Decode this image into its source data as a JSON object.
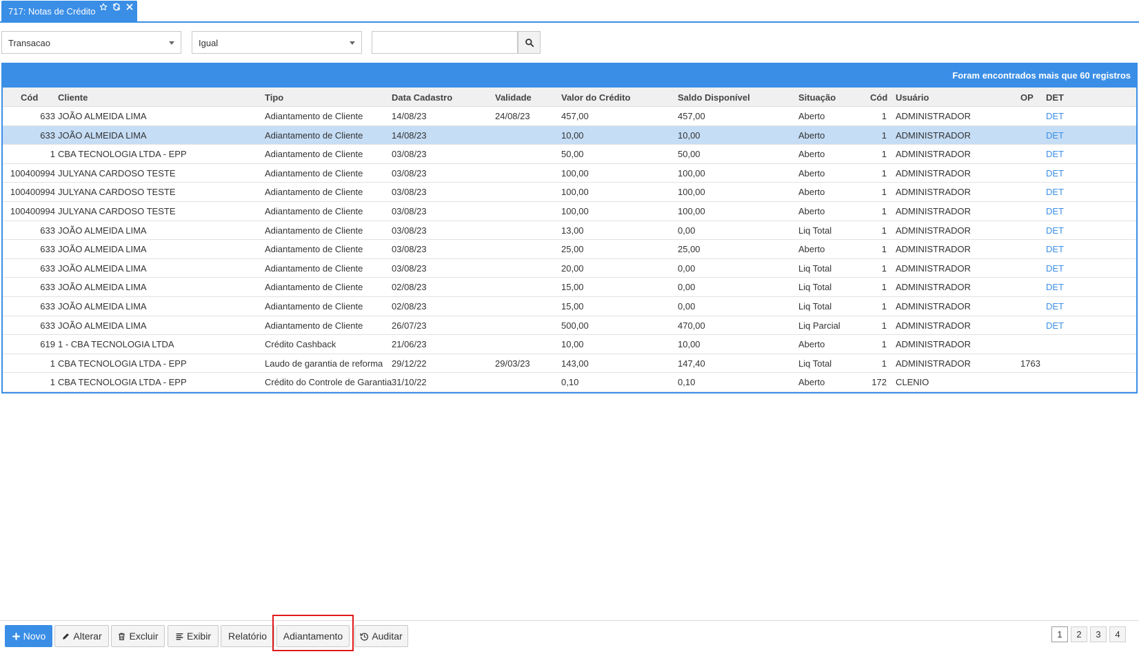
{
  "tab": {
    "title": "717: Notas de Crédito"
  },
  "filters": {
    "field": "Transacao",
    "operator": "Igual",
    "search_value": ""
  },
  "grid": {
    "records_info": "Foram encontrados mais que 60 registros",
    "columns": [
      "Cód",
      "Cliente",
      "Tipo",
      "Data Cadastro",
      "Validade",
      "Valor do Crédito",
      "Saldo Disponível",
      "Situação",
      "Cód",
      "Usuário",
      "OP",
      "DET"
    ],
    "rows": [
      [
        "633",
        "JOÃO ALMEIDA LIMA",
        "Adiantamento de Cliente",
        "14/08/23",
        "24/08/23",
        "457,00",
        "457,00",
        "Aberto",
        "1",
        "ADMINISTRADOR",
        "",
        "DET"
      ],
      [
        "633",
        "JOÃO ALMEIDA LIMA",
        "Adiantamento de Cliente",
        "14/08/23",
        "",
        "10,00",
        "10,00",
        "Aberto",
        "1",
        "ADMINISTRADOR",
        "",
        "DET"
      ],
      [
        "1",
        "CBA TECNOLOGIA LTDA - EPP",
        "Adiantamento de Cliente",
        "03/08/23",
        "",
        "50,00",
        "50,00",
        "Aberto",
        "1",
        "ADMINISTRADOR",
        "",
        "DET"
      ],
      [
        "100400994",
        "JULYANA CARDOSO TESTE",
        "Adiantamento de Cliente",
        "03/08/23",
        "",
        "100,00",
        "100,00",
        "Aberto",
        "1",
        "ADMINISTRADOR",
        "",
        "DET"
      ],
      [
        "100400994",
        "JULYANA CARDOSO TESTE",
        "Adiantamento de Cliente",
        "03/08/23",
        "",
        "100,00",
        "100,00",
        "Aberto",
        "1",
        "ADMINISTRADOR",
        "",
        "DET"
      ],
      [
        "100400994",
        "JULYANA CARDOSO TESTE",
        "Adiantamento de Cliente",
        "03/08/23",
        "",
        "100,00",
        "100,00",
        "Aberto",
        "1",
        "ADMINISTRADOR",
        "",
        "DET"
      ],
      [
        "633",
        "JOÃO ALMEIDA LIMA",
        "Adiantamento de Cliente",
        "03/08/23",
        "",
        "13,00",
        "0,00",
        "Liq Total",
        "1",
        "ADMINISTRADOR",
        "",
        "DET"
      ],
      [
        "633",
        "JOÃO ALMEIDA LIMA",
        "Adiantamento de Cliente",
        "03/08/23",
        "",
        "25,00",
        "25,00",
        "Aberto",
        "1",
        "ADMINISTRADOR",
        "",
        "DET"
      ],
      [
        "633",
        "JOÃO ALMEIDA LIMA",
        "Adiantamento de Cliente",
        "03/08/23",
        "",
        "20,00",
        "0,00",
        "Liq Total",
        "1",
        "ADMINISTRADOR",
        "",
        "DET"
      ],
      [
        "633",
        "JOÃO ALMEIDA LIMA",
        "Adiantamento de Cliente",
        "02/08/23",
        "",
        "15,00",
        "0,00",
        "Liq Total",
        "1",
        "ADMINISTRADOR",
        "",
        "DET"
      ],
      [
        "633",
        "JOÃO ALMEIDA LIMA",
        "Adiantamento de Cliente",
        "02/08/23",
        "",
        "15,00",
        "0,00",
        "Liq Total",
        "1",
        "ADMINISTRADOR",
        "",
        "DET"
      ],
      [
        "633",
        "JOÃO ALMEIDA LIMA",
        "Adiantamento de Cliente",
        "26/07/23",
        "",
        "500,00",
        "470,00",
        "Liq Parcial",
        "1",
        "ADMINISTRADOR",
        "",
        "DET"
      ],
      [
        "619",
        "1 - CBA TECNOLOGIA LTDA",
        "Crédito Cashback",
        "21/06/23",
        "",
        "10,00",
        "10,00",
        "Aberto",
        "1",
        "ADMINISTRADOR",
        "",
        ""
      ],
      [
        "1",
        "CBA TECNOLOGIA LTDA - EPP",
        "Laudo de garantia de reforma",
        "29/12/22",
        "29/03/23",
        "143,00",
        "147,40",
        "Liq Total",
        "1",
        "ADMINISTRADOR",
        "1763",
        ""
      ],
      [
        "1",
        "CBA TECNOLOGIA LTDA - EPP",
        "Crédito do Controle de Garantia",
        "31/10/22",
        "",
        "0,10",
        "0,10",
        "Aberto",
        "172",
        "CLENIO",
        "",
        ""
      ]
    ],
    "selected_row": 1
  },
  "toolbar": {
    "novo": "Novo",
    "alterar": "Alterar",
    "excluir": "Excluir",
    "exibir": "Exibir",
    "relatorio": "Relatório",
    "adiantamento": "Adiantamento",
    "auditar": "Auditar"
  },
  "pagination": {
    "pages": [
      "1",
      "2",
      "3",
      "4"
    ],
    "current": "1"
  },
  "colors": {
    "accent": "#3a8ee6",
    "selected_row": "#c5ddf5",
    "highlight": "#e0191a"
  }
}
